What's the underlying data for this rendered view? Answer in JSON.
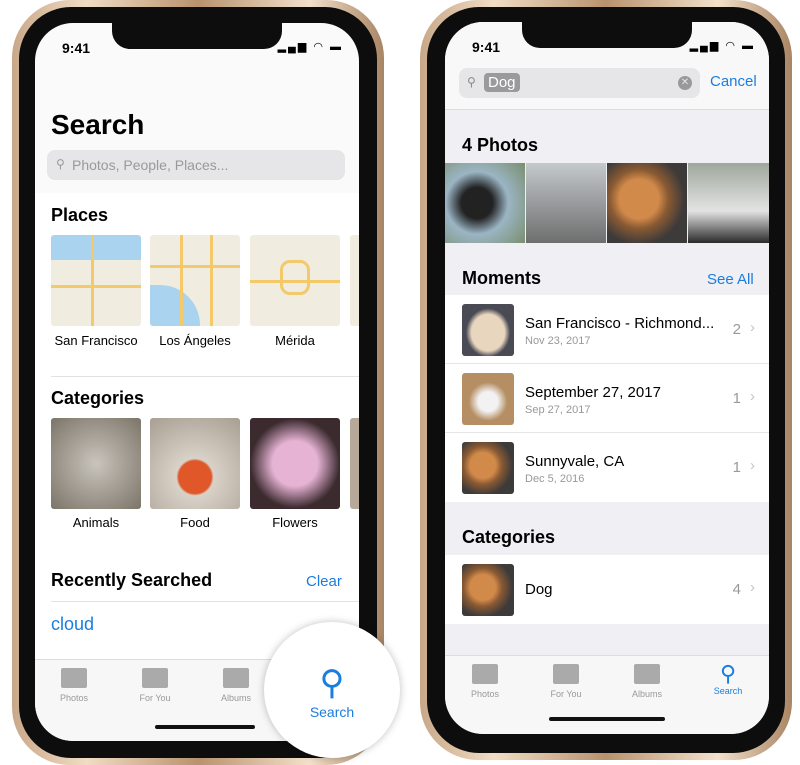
{
  "left": {
    "time": "9:41",
    "title": "Search",
    "search_placeholder": "Photos, People, Places...",
    "places_header": "Places",
    "places": [
      {
        "label": "San Francisco"
      },
      {
        "label": "Los Ángeles"
      },
      {
        "label": "Mérida"
      }
    ],
    "categories_header": "Categories",
    "categories": [
      {
        "label": "Animals"
      },
      {
        "label": "Food"
      },
      {
        "label": "Flowers"
      }
    ],
    "recent_header": "Recently Searched",
    "clear_label": "Clear",
    "recent_items": [
      "cloud"
    ],
    "tabs": [
      "Photos",
      "For You",
      "Albums",
      "Search"
    ],
    "active_tab": "Search"
  },
  "right": {
    "time": "9:41",
    "search_value": "Dog",
    "cancel_label": "Cancel",
    "photos_header": "4 Photos",
    "moments_header": "Moments",
    "see_all_label": "See All",
    "moments": [
      {
        "title": "San Francisco - Richmond...",
        "date": "Nov 23, 2017",
        "count": "2"
      },
      {
        "title": "September 27, 2017",
        "date": "Sep 27, 2017",
        "count": "1"
      },
      {
        "title": "Sunnyvale, CA",
        "date": "Dec 5, 2016",
        "count": "1"
      }
    ],
    "categories_header": "Categories",
    "categories": [
      {
        "title": "Dog",
        "count": "4"
      }
    ],
    "tabs": [
      "Photos",
      "For You",
      "Albums",
      "Search"
    ],
    "active_tab": "Search"
  },
  "colors": {
    "accent": "#1a7ee0",
    "background_grouped": "#efeff4"
  }
}
